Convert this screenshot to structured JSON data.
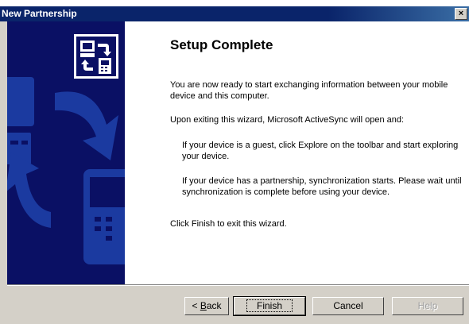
{
  "window": {
    "title": "New Partnership",
    "close_label": "×"
  },
  "wizard": {
    "heading": "Setup Complete",
    "paragraphs": [
      "You are now ready to start exchanging information between your mobile device and this computer.",
      "Upon exiting this wizard, Microsoft ActiveSync will open and:",
      "If your device is a guest, click Explore on the toolbar and start exploring your device.",
      "If your device has a partnership, synchronization starts. Please wait until synchronization is complete before using your device.",
      "Click Finish to exit this wizard."
    ]
  },
  "buttons": {
    "back_prefix": "< ",
    "back_accel": "B",
    "back_rest": "ack",
    "finish": "Finish",
    "cancel": "Cancel",
    "help": "Help"
  },
  "colors": {
    "titlebar": "#0a246a",
    "banner": "#0a1064",
    "banner_shapes": "#1b3aa0",
    "dialog_face": "#d4d0c8"
  },
  "icons": [
    "pc-sync-icon",
    "desktop-illustration",
    "arrow-illustration",
    "handheld-illustration",
    "close-icon"
  ]
}
